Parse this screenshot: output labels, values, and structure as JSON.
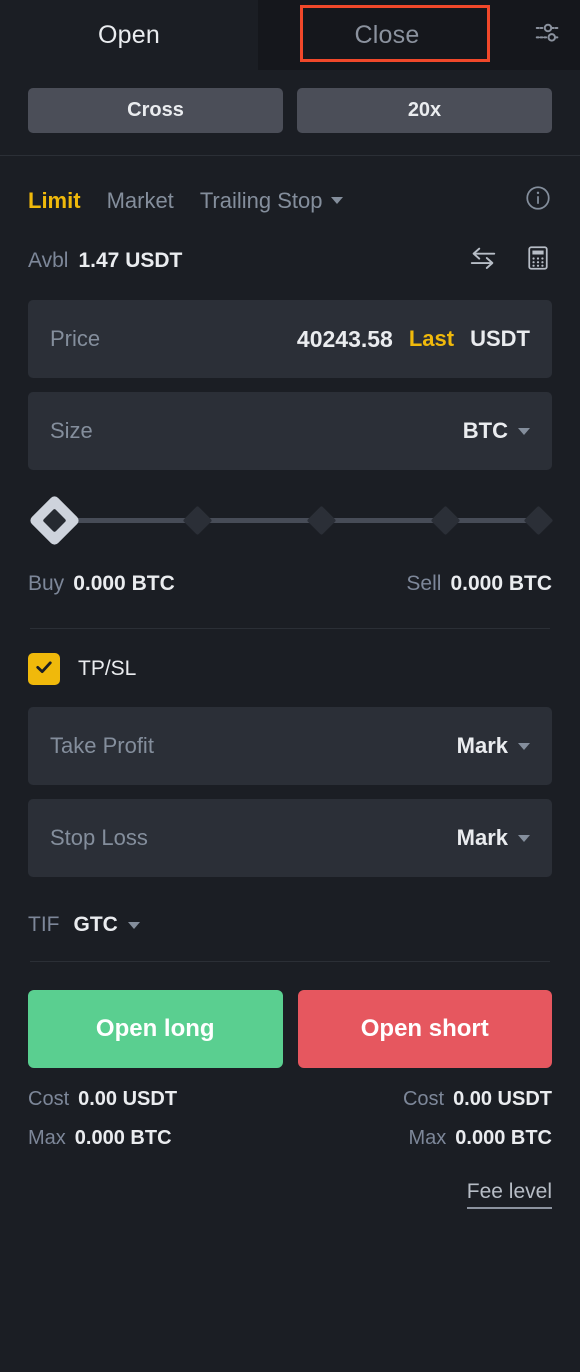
{
  "top_tabs": {
    "open_label": "Open",
    "close_label": "Close",
    "settings_icon": "sliders-settings-icon",
    "highlight_color": "#f0482a"
  },
  "margin": {
    "mode_label": "Cross",
    "leverage_label": "20x"
  },
  "order_types": {
    "items": [
      {
        "label": "Limit",
        "active": true
      },
      {
        "label": "Market",
        "active": false
      },
      {
        "label": "Trailing Stop",
        "active": false,
        "has_caret": true
      }
    ],
    "info_icon": "info-circle-icon",
    "active_color": "#f0b90b"
  },
  "available": {
    "label": "Avbl",
    "value": "1.47 USDT",
    "transfer_icon": "transfer-arrows-icon",
    "calculator_icon": "calculator-icon"
  },
  "price_field": {
    "placeholder": "Price",
    "value": "40243.58",
    "mode_label": "Last",
    "unit_label": "USDT"
  },
  "size_field": {
    "placeholder": "Size",
    "unit_label": "BTC",
    "caret_icon": "chevron-down-icon"
  },
  "slider": {
    "position_percent": 0,
    "tick_count": 5,
    "handle_icon": "diamond-handle-icon"
  },
  "quantities": {
    "buy_label": "Buy",
    "buy_value": "0.000 BTC",
    "sell_label": "Sell",
    "sell_value": "0.000 BTC"
  },
  "tpsl": {
    "label": "TP/SL",
    "checked": true,
    "check_icon": "checkmark-icon",
    "accent_color": "#f0b90b",
    "take_profit": {
      "placeholder": "Take Profit",
      "trigger_label": "Mark",
      "caret_icon": "chevron-down-icon"
    },
    "stop_loss": {
      "placeholder": "Stop Loss",
      "trigger_label": "Mark",
      "caret_icon": "chevron-down-icon"
    }
  },
  "tif": {
    "label": "TIF",
    "value": "GTC",
    "caret_icon": "chevron-down-icon"
  },
  "actions": {
    "long_label": "Open long",
    "short_label": "Open short",
    "long_color": "#5acf90",
    "short_color": "#e6575f"
  },
  "summary": {
    "long": {
      "cost_label": "Cost",
      "cost_value": "0.00 USDT",
      "max_label": "Max",
      "max_value": "0.000 BTC"
    },
    "short": {
      "cost_label": "Cost",
      "cost_value": "0.00 USDT",
      "max_label": "Max",
      "max_value": "0.000 BTC"
    }
  },
  "fee": {
    "link_label": "Fee level"
  }
}
